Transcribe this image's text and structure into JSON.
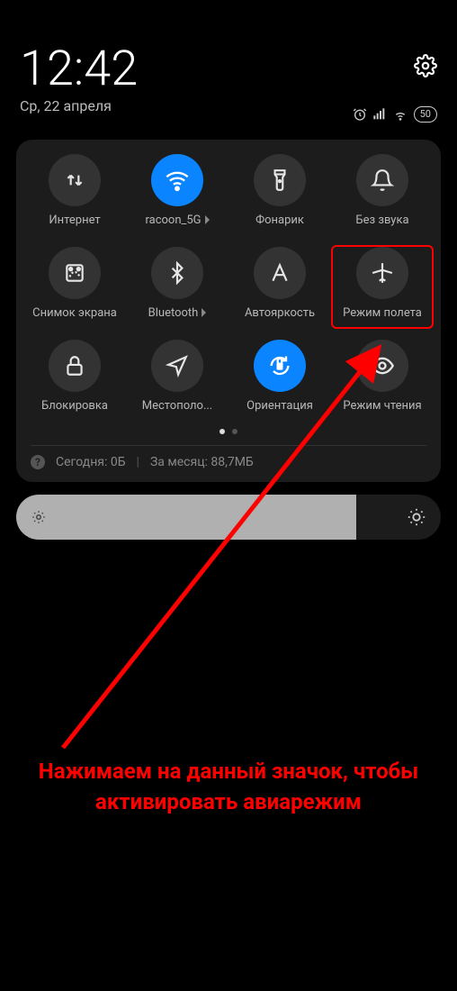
{
  "status": {
    "time": "12:42",
    "date": "Ср, 22 апреля",
    "battery_text": "50"
  },
  "tiles": {
    "internet": {
      "label": "Интернет"
    },
    "wifi": {
      "label": "racoon_5G"
    },
    "torch": {
      "label": "Фонарик"
    },
    "silent": {
      "label": "Без звука"
    },
    "screenshot": {
      "label": "Снимок экрана"
    },
    "bluetooth": {
      "label": "Bluetooth"
    },
    "autobrightness": {
      "label": "Автояркость"
    },
    "airplane": {
      "label": "Режим полета"
    },
    "lock": {
      "label": "Блокировка"
    },
    "location": {
      "label": "Местополо..."
    },
    "orientation": {
      "label": "Ориентация"
    },
    "reading": {
      "label": "Режим чтения"
    }
  },
  "usage": {
    "today": "Сегодня: 0Б",
    "month": "За месяц: 88,7МБ"
  },
  "annotation": {
    "line1": "Нажимаем на данный значок, чтобы",
    "line2": "активировать авиарежим"
  }
}
